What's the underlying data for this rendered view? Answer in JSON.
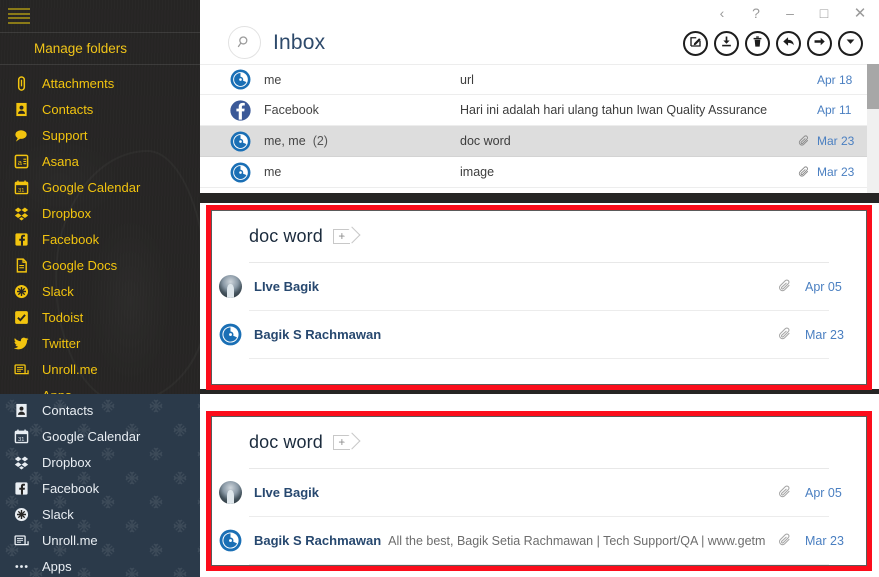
{
  "sidebar": {
    "hamburger_icon": "hamburger-menu-icon",
    "manage_label": "Manage folders",
    "top_items": [
      {
        "label": "Attachments",
        "icon": "paperclip-icon"
      },
      {
        "label": "Contacts",
        "icon": "contacts-icon"
      },
      {
        "label": "Support",
        "icon": "chat-bubble-icon"
      },
      {
        "label": "Asana",
        "icon": "asana-icon"
      },
      {
        "label": "Google Calendar",
        "icon": "calendar-icon"
      },
      {
        "label": "Dropbox",
        "icon": "dropbox-icon"
      },
      {
        "label": "Facebook",
        "icon": "facebook-icon"
      },
      {
        "label": "Google Docs",
        "icon": "google-docs-icon"
      },
      {
        "label": "Slack",
        "icon": "slack-icon"
      },
      {
        "label": "Todoist",
        "icon": "todoist-check-icon"
      },
      {
        "label": "Twitter",
        "icon": "twitter-bird-icon"
      },
      {
        "label": "Unroll.me",
        "icon": "unrollme-icon"
      },
      {
        "label": "Apps",
        "icon": "apps-dots-icon"
      }
    ],
    "bottom_items": [
      {
        "label": "Contacts",
        "icon": "contacts-icon"
      },
      {
        "label": "Google Calendar",
        "icon": "calendar-icon"
      },
      {
        "label": "Dropbox",
        "icon": "dropbox-icon"
      },
      {
        "label": "Facebook",
        "icon": "facebook-icon"
      },
      {
        "label": "Slack",
        "icon": "slack-icon"
      },
      {
        "label": "Unroll.me",
        "icon": "unrollme-icon"
      },
      {
        "label": "Apps",
        "icon": "apps-dots-icon"
      }
    ],
    "colors": {
      "top_bg": "#262524",
      "top_text": "#f2c40f",
      "bottom_bg": "#2b3a4a",
      "bottom_text": "#e9eef3"
    }
  },
  "window_controls": [
    {
      "name": "back-button",
      "glyph": "‹"
    },
    {
      "name": "help-button",
      "glyph": "?"
    },
    {
      "name": "minimize-button",
      "glyph": "–"
    },
    {
      "name": "maximize-button",
      "glyph": "□"
    },
    {
      "name": "close-button",
      "glyph": "✕"
    }
  ],
  "header": {
    "search_icon": "search-magnifier-icon",
    "title": "Inbox",
    "actions": [
      {
        "name": "compose-button",
        "icon": "compose-pencil-icon"
      },
      {
        "name": "archive-button",
        "icon": "download-arrow-icon"
      },
      {
        "name": "delete-button",
        "icon": "trash-icon"
      },
      {
        "name": "reply-button",
        "icon": "reply-arrow-icon"
      },
      {
        "name": "forward-button",
        "icon": "forward-arrow-icon"
      },
      {
        "name": "more-button",
        "icon": "chevron-down-icon"
      }
    ]
  },
  "message_list": {
    "rows": [
      {
        "sender": "me",
        "count": "",
        "subject": "url",
        "attachment": false,
        "date": "Apr 18",
        "selected": false,
        "avatar": "mailbird-logo"
      },
      {
        "sender": "Facebook",
        "count": "",
        "subject": "Hari ini adalah hari ulang tahun Iwan Quality Assurance",
        "attachment": false,
        "date": "Apr 11",
        "selected": false,
        "avatar": "facebook-logo"
      },
      {
        "sender": "me, me",
        "count": "(2)",
        "subject": "doc word",
        "attachment": true,
        "date": "Mar 23",
        "selected": true,
        "avatar": "mailbird-logo"
      },
      {
        "sender": "me",
        "count": "",
        "subject": "image",
        "attachment": true,
        "date": "Mar 23",
        "selected": false,
        "avatar": "mailbird-logo"
      }
    ]
  },
  "panels": [
    {
      "name": "conversation-panel-1",
      "title": "doc word",
      "tag_button": "add-tag-button",
      "rows": [
        {
          "name": "LIve Bagik",
          "snippet": "",
          "attachment": true,
          "date": "Apr 05",
          "avatar": "photo-avatar"
        },
        {
          "name": "Bagik S Rachmawan",
          "snippet": "",
          "attachment": true,
          "date": "Mar 23",
          "avatar": "mailbird-logo"
        }
      ]
    },
    {
      "name": "conversation-panel-2",
      "title": "doc word",
      "tag_button": "add-tag-button",
      "rows": [
        {
          "name": "LIve Bagik",
          "snippet": "",
          "attachment": true,
          "date": "Apr 05",
          "avatar": "photo-avatar"
        },
        {
          "name": "Bagik S Rachmawan",
          "snippet": "All the best, Bagik Setia Rachmawan | Tech Support/QA | www.getmailb...",
          "attachment": true,
          "date": "Mar 23",
          "avatar": "mailbird-logo"
        }
      ]
    }
  ],
  "annotation": {
    "highlight_color": "#fc0d1b"
  }
}
